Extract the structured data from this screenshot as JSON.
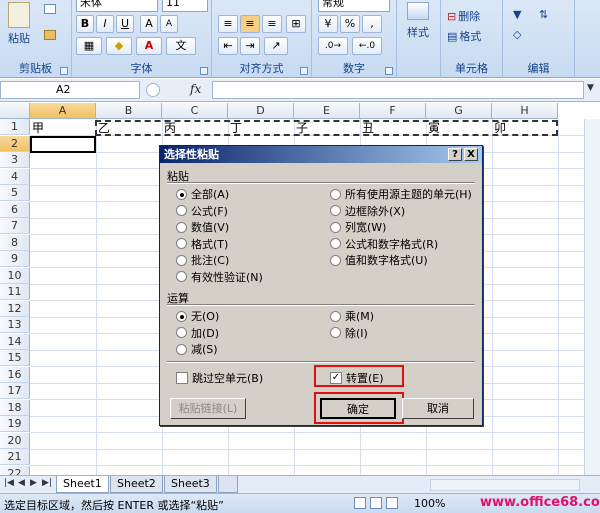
{
  "ribbon": {
    "font_name": "宋体",
    "font_size": "11",
    "number_format": "常规",
    "groups": {
      "clipboard": "剪贴板",
      "font": "字体",
      "alignment": "对齐方式",
      "number": "数字",
      "cells": "单元格",
      "editing": "编辑"
    },
    "paste_label": "粘贴",
    "styles_label": "样式",
    "delete_label": "删除",
    "format_label": "格式",
    "bold": "B",
    "italic": "I",
    "underline": "U",
    "percent": "%",
    "comma": ","
  },
  "formula_bar": {
    "name_box": "A2",
    "fx": "fx",
    "formula": ""
  },
  "sheet": {
    "columns": [
      "A",
      "B",
      "C",
      "D",
      "E",
      "F",
      "G",
      "H"
    ],
    "rows": [
      "1",
      "2",
      "3",
      "4",
      "5",
      "6",
      "7",
      "8",
      "9",
      "10",
      "11",
      "12",
      "13",
      "14",
      "15",
      "16",
      "17",
      "18",
      "19",
      "20",
      "21",
      "22"
    ],
    "row1_values": [
      "甲",
      "乙",
      "丙",
      "丁",
      "子",
      "丑",
      "寅",
      "卯"
    ]
  },
  "tabs": [
    "Sheet1",
    "Sheet2",
    "Sheet3"
  ],
  "status": {
    "message": "选定目标区域，然后按 ENTER 或选择“粘贴”",
    "zoom": "100%",
    "watermark": "www.office68.com"
  },
  "dialog": {
    "title": "选择性粘贴",
    "help_btn": "?",
    "close_btn": "X",
    "paste_section": "粘贴",
    "paste_options_left": [
      "全部(A)",
      "公式(F)",
      "数值(V)",
      "格式(T)",
      "批注(C)",
      "有效性验证(N)"
    ],
    "paste_options_right": [
      "所有使用源主题的单元(H)",
      "边框除外(X)",
      "列宽(W)",
      "公式和数字格式(R)",
      "值和数字格式(U)"
    ],
    "operation_section": "运算",
    "operation_left": [
      "无(O)",
      "加(D)",
      "减(S)"
    ],
    "operation_right": [
      "乘(M)",
      "除(I)"
    ],
    "skip_blanks": "跳过空单元(B)",
    "transpose": "转置(E)",
    "paste_link": "粘贴链接(L)",
    "ok": "确定",
    "cancel": "取消"
  },
  "colors": {
    "highlight_box": "#e01010",
    "watermark": "#e0106a"
  }
}
